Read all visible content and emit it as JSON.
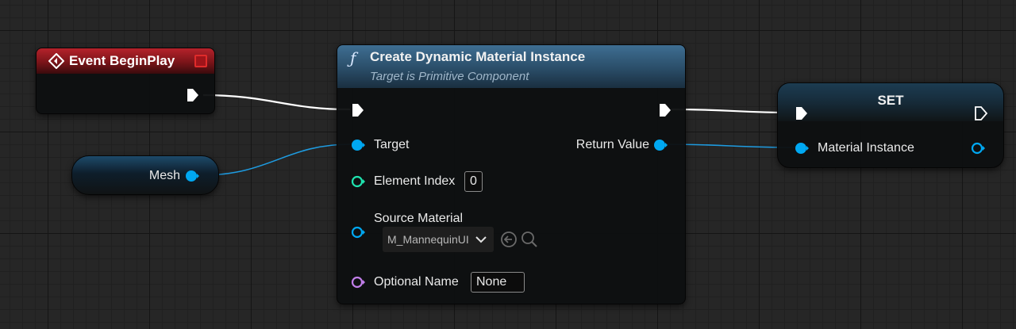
{
  "event_node": {
    "title": "Event BeginPlay"
  },
  "mesh_node": {
    "label": "Mesh"
  },
  "function_node": {
    "icon": "function-icon",
    "title": "Create Dynamic Material Instance",
    "subtitle": "Target is Primitive Component",
    "pins": {
      "target": "Target",
      "element_index": "Element Index",
      "element_index_value": "0",
      "source_material": "Source Material",
      "source_material_value": "M_MannequinUI",
      "optional_name": "Optional Name",
      "optional_name_value": "None",
      "return_value": "Return Value"
    }
  },
  "set_node": {
    "title": "SET",
    "pin_label": "Material Instance"
  },
  "colors": {
    "exec": "#ffffff",
    "object_pin": "#00a8f2",
    "int_pin": "#1fe3af",
    "name_pin": "#c17ee9",
    "event_header": "#b5222b",
    "function_header": "#3e6e92",
    "wire_object": "#1e9be0",
    "wire_exec": "#ffffff"
  }
}
